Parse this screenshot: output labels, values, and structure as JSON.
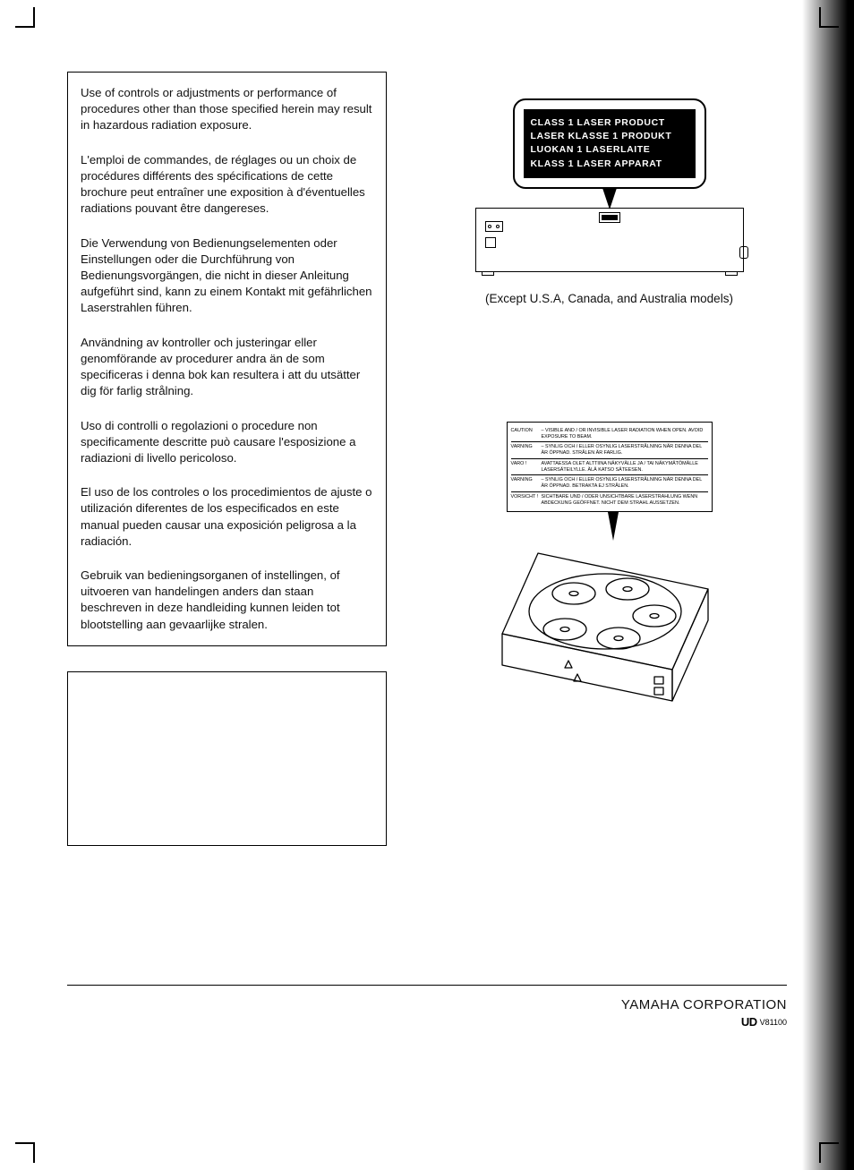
{
  "warnings": {
    "en": "Use of controls or adjustments or performance of procedures other than those specified herein may result in hazardous radiation exposure.",
    "fr": "L'emploi de commandes, de réglages ou un choix de procédures différents des spécifications de cette brochure peut entraîner une exposition à d'éventuelles radiations pouvant être dangereses.",
    "de": "Die Verwendung von Bedienungselementen oder Einstellungen oder die Durchführung von Bedienungsvorgängen, die nicht in dieser Anleitung aufgeführt sind, kann zu einem Kontakt mit gefährlichen Laserstrahlen führen.",
    "sv": "Användning av kontroller och justeringar eller genomförande av procedurer andra än de som specificeras i denna bok kan resultera i att du utsätter dig för farlig strålning.",
    "it": "Uso di controlli o regolazioni o procedure non specificamente descritte può causare l'esposizione a radiazioni di livello pericoloso.",
    "es": "El uso de los controles o los procedimientos de ajuste o utilización diferentes de los especificados en este manual pueden causar una exposición peligrosa a la radiación.",
    "nl": "Gebruik van bedieningsorganen of instellingen, of uitvoeren van handelingen anders dan staan beschreven in deze handleiding kunnen leiden tot blootstelling aan gevaarlijke stralen."
  },
  "laser_label": {
    "line1": "CLASS 1 LASER PRODUCT",
    "line2": "LASER KLASSE 1 PRODUKT",
    "line3": "LUOKAN 1 LASERLAITE",
    "line4": "KLASS 1 LASER APPARAT"
  },
  "caption_rear": "(Except U.S.A, Canada, and Australia models)",
  "caution_table": [
    {
      "label": "CAUTION",
      "sep": "–",
      "text": "VISIBLE AND / OR INVISIBLE LASER RADIATION WHEN OPEN. AVOID EXPOSURE TO BEAM."
    },
    {
      "label": "VARNING",
      "sep": "–",
      "text": "SYNLIG OCH / ELLER OSYNLIG LASERSTRÅLNING NÄR DENNA DEL ÄR ÖPPNAD. STRÅLEN ÄR FARLIG."
    },
    {
      "label": "VARO !",
      "sep": "",
      "text": "AVATTAESSA OLET ALTTIINA NÄKYVÄLLE JA / TAI NÄKYMÄTÖMÄLLE LASERSÄTEILYLLE. ÄLÄ KATSO SÄTEESEN."
    },
    {
      "label": "VARNING",
      "sep": "–",
      "text": "SYNLIG OCH / ELLER OSYNLIG LASERSTRÅLNING NÄR DENNA DEL ÄR ÖPPNAD. BETRAKTA EJ STRÅLEN."
    },
    {
      "label": "VORSICHT !",
      "sep": "",
      "text": "SICHTBARE UND / ODER UNSICHTBARE LASERSTRAHLUNG WENN ABDECKUNG GEÖFFNET. NICHT DEM STRAHL AUSSETZEN."
    }
  ],
  "footer": {
    "brand": "YAMAHA CORPORATION",
    "sub_logo": "UD",
    "sub_text": "V81100"
  }
}
